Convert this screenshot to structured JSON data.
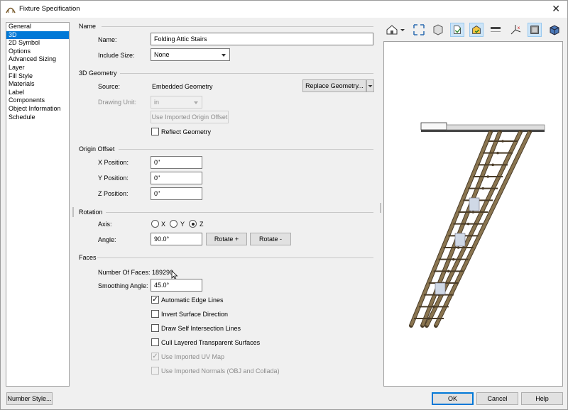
{
  "window": {
    "title": "Fixture Specification",
    "close_glyph": "✕"
  },
  "nav": {
    "items": [
      "General",
      "3D",
      "2D Symbol",
      "Options",
      "Advanced Sizing",
      "Layer",
      "Fill Style",
      "Materials",
      "Label",
      "Components",
      "Object Information",
      "Schedule"
    ],
    "selected_index": 1
  },
  "name_section": {
    "heading": "Name",
    "name_label": "Name:",
    "name_value": "Folding Attic Stairs",
    "include_size_label": "Include Size:",
    "include_size_value": "None"
  },
  "geometry": {
    "heading": "3D Geometry",
    "source_label": "Source:",
    "source_value": "Embedded Geometry",
    "replace_button": "Replace Geometry...",
    "drawing_unit_label": "Drawing Unit:",
    "drawing_unit_value": "in",
    "origin_offset_button": "Use Imported Origin Offset",
    "reflect_label": "Reflect Geometry",
    "reflect_checked": false
  },
  "origin": {
    "heading": "Origin Offset",
    "x_label": "X Position:",
    "x_value": "0\"",
    "y_label": "Y Position:",
    "y_value": "0\"",
    "z_label": "Z Position:",
    "z_value": "0\""
  },
  "rotation": {
    "heading": "Rotation",
    "axis_label": "Axis:",
    "axis_x": "X",
    "axis_y": "Y",
    "axis_z": "Z",
    "axis_selected": "Z",
    "angle_label": "Angle:",
    "angle_value": "90.0°",
    "rotate_plus": "Rotate +",
    "rotate_minus": "Rotate -"
  },
  "faces": {
    "heading": "Faces",
    "count_label": "Number Of Faces:",
    "count_value": "189290",
    "smoothing_label": "Smoothing Angle:",
    "smoothing_value": "45.0°",
    "options": [
      {
        "label": "Automatic Edge Lines",
        "checked": true,
        "disabled": false
      },
      {
        "label": "Invert Surface Direction",
        "checked": false,
        "disabled": false
      },
      {
        "label": "Draw Self Intersection Lines",
        "checked": false,
        "disabled": false
      },
      {
        "label": "Cull Layered Transparent Surfaces",
        "checked": false,
        "disabled": false
      },
      {
        "label": "Use Imported UV Map",
        "checked": true,
        "disabled": true
      },
      {
        "label": "Use Imported Normals (OBJ and Collada)",
        "checked": false,
        "disabled": true
      }
    ]
  },
  "footer": {
    "number_style": "Number Style...",
    "ok": "OK",
    "cancel": "Cancel",
    "help": "Help"
  },
  "toolbar_icons": [
    "camera-view-icon",
    "fit-window-icon",
    "isometric-view-icon",
    "wireframe-toggle-icon",
    "color-toggle-icon",
    "floor-level-icon",
    "axis-toggle-icon",
    "render-mode-icon",
    "cube-view-icon"
  ],
  "colors": {
    "accent": "#0078d7",
    "ladder_wood": "#8a7550",
    "ladder_dark": "#4a3c28"
  }
}
